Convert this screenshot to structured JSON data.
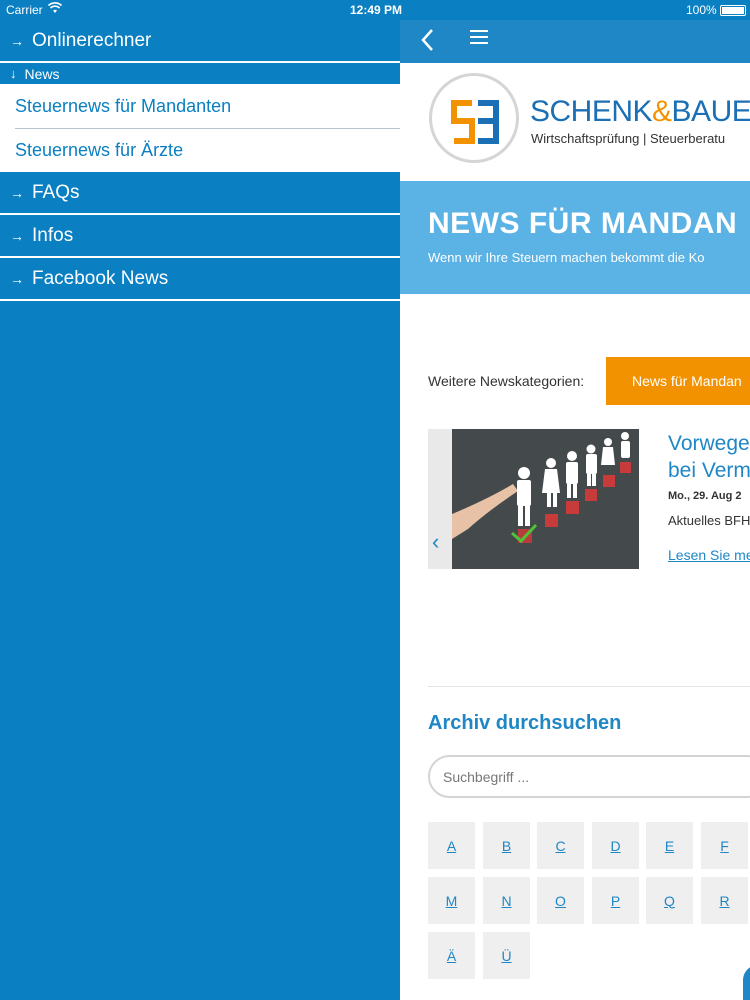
{
  "status": {
    "carrier": "Carrier",
    "time": "12:49 PM",
    "battery": "100%"
  },
  "sidebar": {
    "items": [
      {
        "label": "Onlinerechner"
      }
    ],
    "news_header": "News",
    "sub_items": [
      {
        "label": "Steuernews für Mandanten"
      },
      {
        "label": "Steuernews für Ärzte"
      }
    ],
    "bottom_items": [
      {
        "label": "FAQs"
      },
      {
        "label": "Infos"
      },
      {
        "label": "Facebook News"
      }
    ]
  },
  "brand": {
    "name_part1": "SCHENK",
    "amp": "&",
    "name_part2": "BAUE",
    "subtitle": "Wirtschaftsprüfung | Steuerberatu"
  },
  "hero": {
    "title": "NEWS FÜR MANDAN",
    "subtitle": "Wenn wir Ihre Steuern machen bekommt die Ko"
  },
  "categories": {
    "label": "Weitere Newskategorien:",
    "button": "News für Mandan"
  },
  "news": {
    "title_line1": "Vorwege",
    "title_line2": "bei Verm",
    "date": "Mo., 29. Aug 2",
    "excerpt": "Aktuelles BFH",
    "more": "Lesen Sie me"
  },
  "archive": {
    "title": "Archiv durchsuchen",
    "search_placeholder": "Suchbegriff ...",
    "letters": [
      "A",
      "B",
      "C",
      "D",
      "E",
      "F",
      "M",
      "N",
      "O",
      "P",
      "Q",
      "R",
      "Ä",
      "Ü"
    ]
  },
  "colors": {
    "primary": "#0a7fc2",
    "accent": "#f39200",
    "hero": "#5bb2e5"
  }
}
